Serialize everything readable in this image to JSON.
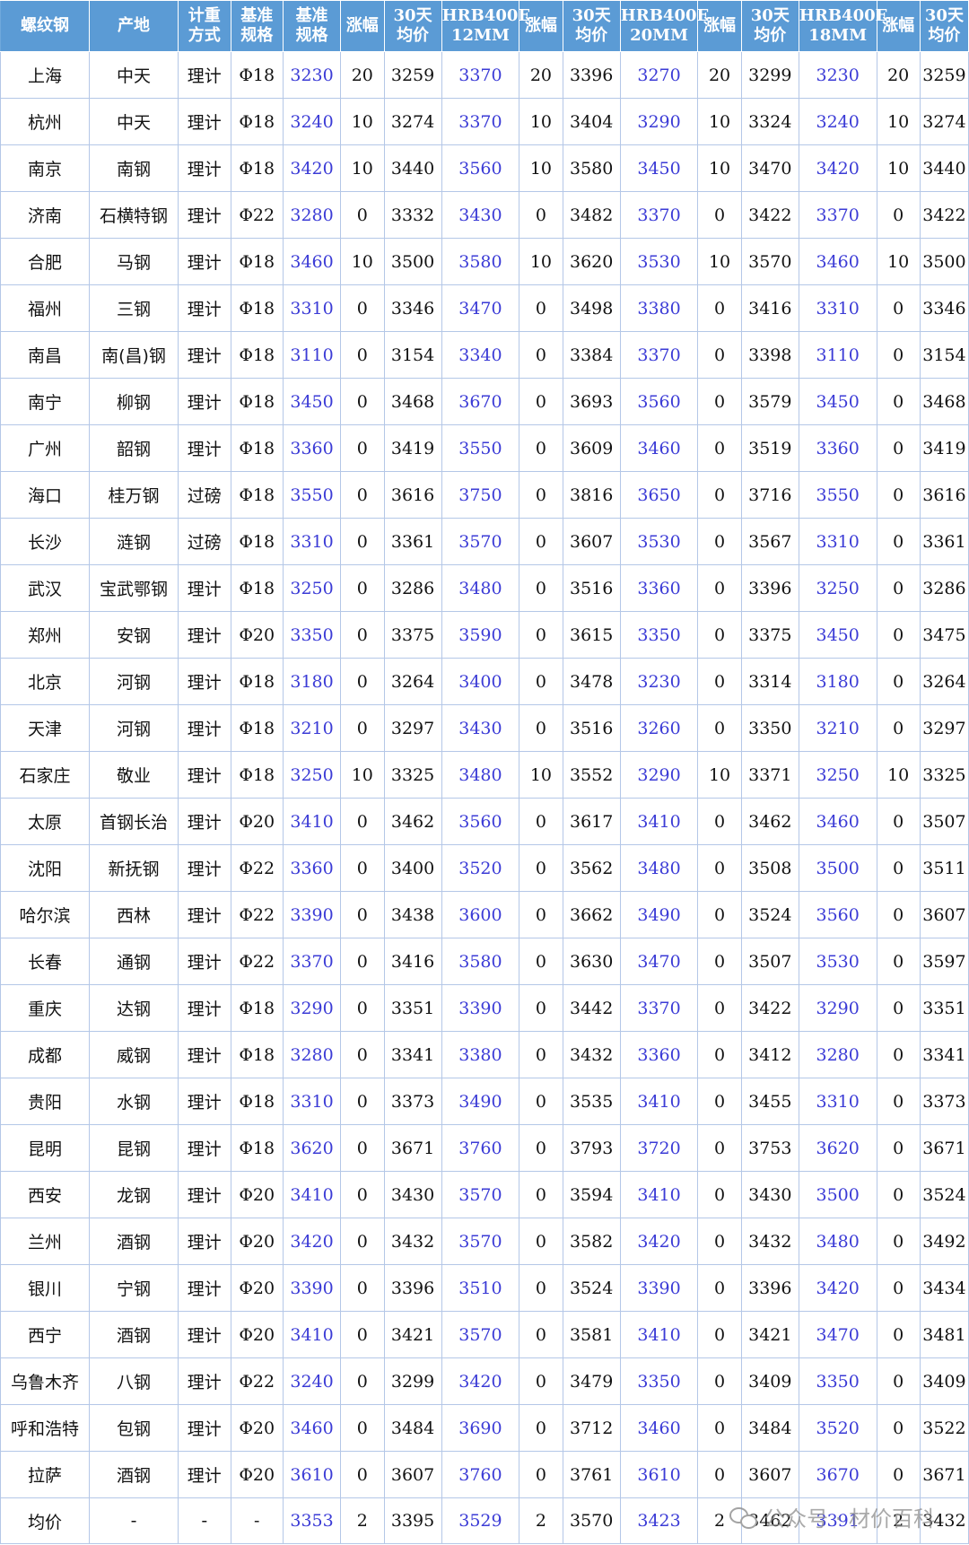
{
  "table": {
    "headers": [
      [
        "螺纹钢"
      ],
      [
        "产地"
      ],
      [
        "计重",
        "方式"
      ],
      [
        "基准",
        "规格"
      ],
      [
        "基准",
        "规格"
      ],
      [
        "涨幅"
      ],
      [
        "30天",
        "均价"
      ],
      [
        "HRB400E",
        "12MM"
      ],
      [
        "涨幅"
      ],
      [
        "30天",
        "均价"
      ],
      [
        "HRB400E",
        "20MM"
      ],
      [
        "涨幅"
      ],
      [
        "30天",
        "均价"
      ],
      [
        "HRB400E",
        "18MM"
      ],
      [
        "涨幅"
      ],
      [
        "30天",
        "均价"
      ]
    ],
    "rows": [
      [
        "上海",
        "中天",
        "理计",
        "Φ18",
        "3230",
        "20",
        "3259",
        "3370",
        "20",
        "3396",
        "3270",
        "20",
        "3299",
        "3230",
        "20",
        "3259"
      ],
      [
        "杭州",
        "中天",
        "理计",
        "Φ18",
        "3240",
        "10",
        "3274",
        "3370",
        "10",
        "3404",
        "3290",
        "10",
        "3324",
        "3240",
        "10",
        "3274"
      ],
      [
        "南京",
        "南钢",
        "理计",
        "Φ18",
        "3420",
        "10",
        "3440",
        "3560",
        "10",
        "3580",
        "3450",
        "10",
        "3470",
        "3420",
        "10",
        "3440"
      ],
      [
        "济南",
        "石横特钢",
        "理计",
        "Φ22",
        "3280",
        "0",
        "3332",
        "3430",
        "0",
        "3482",
        "3370",
        "0",
        "3422",
        "3370",
        "0",
        "3422"
      ],
      [
        "合肥",
        "马钢",
        "理计",
        "Φ18",
        "3460",
        "10",
        "3500",
        "3580",
        "10",
        "3620",
        "3530",
        "10",
        "3570",
        "3460",
        "10",
        "3500"
      ],
      [
        "福州",
        "三钢",
        "理计",
        "Φ18",
        "3310",
        "0",
        "3346",
        "3470",
        "0",
        "3498",
        "3380",
        "0",
        "3416",
        "3310",
        "0",
        "3346"
      ],
      [
        "南昌",
        "南(昌)钢",
        "理计",
        "Φ18",
        "3110",
        "0",
        "3154",
        "3340",
        "0",
        "3384",
        "3370",
        "0",
        "3398",
        "3110",
        "0",
        "3154"
      ],
      [
        "南宁",
        "柳钢",
        "理计",
        "Φ18",
        "3450",
        "0",
        "3468",
        "3670",
        "0",
        "3693",
        "3560",
        "0",
        "3579",
        "3450",
        "0",
        "3468"
      ],
      [
        "广州",
        "韶钢",
        "理计",
        "Φ18",
        "3360",
        "0",
        "3419",
        "3550",
        "0",
        "3609",
        "3460",
        "0",
        "3519",
        "3360",
        "0",
        "3419"
      ],
      [
        "海口",
        "桂万钢",
        "过磅",
        "Φ18",
        "3550",
        "0",
        "3616",
        "3750",
        "0",
        "3816",
        "3650",
        "0",
        "3716",
        "3550",
        "0",
        "3616"
      ],
      [
        "长沙",
        "涟钢",
        "过磅",
        "Φ18",
        "3310",
        "0",
        "3361",
        "3570",
        "0",
        "3607",
        "3530",
        "0",
        "3567",
        "3310",
        "0",
        "3361"
      ],
      [
        "武汉",
        "宝武鄂钢",
        "理计",
        "Φ18",
        "3250",
        "0",
        "3286",
        "3480",
        "0",
        "3516",
        "3360",
        "0",
        "3396",
        "3250",
        "0",
        "3286"
      ],
      [
        "郑州",
        "安钢",
        "理计",
        "Φ20",
        "3350",
        "0",
        "3375",
        "3590",
        "0",
        "3615",
        "3350",
        "0",
        "3375",
        "3450",
        "0",
        "3475"
      ],
      [
        "北京",
        "河钢",
        "理计",
        "Φ18",
        "3180",
        "0",
        "3264",
        "3400",
        "0",
        "3478",
        "3230",
        "0",
        "3314",
        "3180",
        "0",
        "3264"
      ],
      [
        "天津",
        "河钢",
        "理计",
        "Φ18",
        "3210",
        "0",
        "3297",
        "3430",
        "0",
        "3516",
        "3260",
        "0",
        "3350",
        "3210",
        "0",
        "3297"
      ],
      [
        "石家庄",
        "敬业",
        "理计",
        "Φ18",
        "3250",
        "10",
        "3325",
        "3480",
        "10",
        "3552",
        "3290",
        "10",
        "3371",
        "3250",
        "10",
        "3325"
      ],
      [
        "太原",
        "首钢长治",
        "理计",
        "Φ20",
        "3410",
        "0",
        "3462",
        "3560",
        "0",
        "3617",
        "3410",
        "0",
        "3462",
        "3460",
        "0",
        "3507"
      ],
      [
        "沈阳",
        "新抚钢",
        "理计",
        "Φ22",
        "3360",
        "0",
        "3400",
        "3520",
        "0",
        "3562",
        "3480",
        "0",
        "3508",
        "3500",
        "0",
        "3511"
      ],
      [
        "哈尔滨",
        "西林",
        "理计",
        "Φ22",
        "3390",
        "0",
        "3438",
        "3600",
        "0",
        "3662",
        "3490",
        "0",
        "3524",
        "3560",
        "0",
        "3607"
      ],
      [
        "长春",
        "通钢",
        "理计",
        "Φ22",
        "3370",
        "0",
        "3416",
        "3580",
        "0",
        "3630",
        "3470",
        "0",
        "3507",
        "3530",
        "0",
        "3597"
      ],
      [
        "重庆",
        "达钢",
        "理计",
        "Φ18",
        "3290",
        "0",
        "3351",
        "3390",
        "0",
        "3442",
        "3370",
        "0",
        "3422",
        "3290",
        "0",
        "3351"
      ],
      [
        "成都",
        "威钢",
        "理计",
        "Φ18",
        "3280",
        "0",
        "3341",
        "3380",
        "0",
        "3432",
        "3360",
        "0",
        "3412",
        "3280",
        "0",
        "3341"
      ],
      [
        "贵阳",
        "水钢",
        "理计",
        "Φ18",
        "3310",
        "0",
        "3373",
        "3490",
        "0",
        "3535",
        "3410",
        "0",
        "3455",
        "3310",
        "0",
        "3373"
      ],
      [
        "昆明",
        "昆钢",
        "理计",
        "Φ18",
        "3620",
        "0",
        "3671",
        "3760",
        "0",
        "3793",
        "3720",
        "0",
        "3753",
        "3620",
        "0",
        "3671"
      ],
      [
        "西安",
        "龙钢",
        "理计",
        "Φ20",
        "3410",
        "0",
        "3430",
        "3570",
        "0",
        "3594",
        "3410",
        "0",
        "3430",
        "3500",
        "0",
        "3524"
      ],
      [
        "兰州",
        "酒钢",
        "理计",
        "Φ20",
        "3420",
        "0",
        "3432",
        "3570",
        "0",
        "3582",
        "3420",
        "0",
        "3432",
        "3480",
        "0",
        "3492"
      ],
      [
        "银川",
        "宁钢",
        "理计",
        "Φ20",
        "3390",
        "0",
        "3396",
        "3510",
        "0",
        "3524",
        "3390",
        "0",
        "3396",
        "3420",
        "0",
        "3434"
      ],
      [
        "西宁",
        "酒钢",
        "理计",
        "Φ20",
        "3410",
        "0",
        "3421",
        "3570",
        "0",
        "3581",
        "3410",
        "0",
        "3421",
        "3470",
        "0",
        "3481"
      ],
      [
        "乌鲁木齐",
        "八钢",
        "理计",
        "Φ22",
        "3240",
        "0",
        "3299",
        "3420",
        "0",
        "3479",
        "3350",
        "0",
        "3409",
        "3350",
        "0",
        "3409"
      ],
      [
        "呼和浩特",
        "包钢",
        "理计",
        "Φ20",
        "3460",
        "0",
        "3484",
        "3690",
        "0",
        "3712",
        "3460",
        "0",
        "3484",
        "3520",
        "0",
        "3522"
      ],
      [
        "拉萨",
        "酒钢",
        "理计",
        "Φ20",
        "3610",
        "0",
        "3607",
        "3760",
        "0",
        "3761",
        "3610",
        "0",
        "3607",
        "3670",
        "0",
        "3671"
      ],
      [
        "均价",
        "-",
        "-",
        "-",
        "3353",
        "2",
        "3395",
        "3529",
        "2",
        "3570",
        "3423",
        "2",
        "3462",
        "3391",
        "2",
        "3432"
      ]
    ]
  },
  "watermark": {
    "text": "公众号 · 材价百科",
    "icon": "wechat-icon"
  },
  "colors": {
    "header_bg": "#5b9bd5",
    "price_text": "#3b3bd6",
    "grid": "#b4c7e7"
  }
}
